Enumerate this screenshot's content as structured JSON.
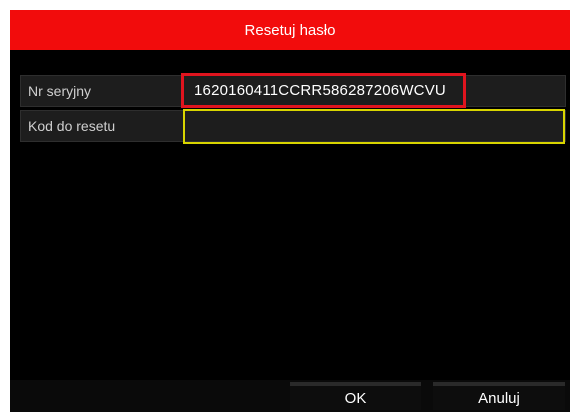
{
  "dialog": {
    "title": "Resetuj hasło"
  },
  "fields": {
    "serial": {
      "label": "Nr seryjny",
      "value": "1620160411CCRR586287206WCVU"
    },
    "reset_code": {
      "label": "Kod do resetu",
      "value": ""
    }
  },
  "buttons": {
    "ok_label": "OK",
    "cancel_label": "Anuluj"
  },
  "colors": {
    "title_bar": "#f20c0c",
    "highlight_border": "#e0141e",
    "focus_border": "#d8d400"
  }
}
